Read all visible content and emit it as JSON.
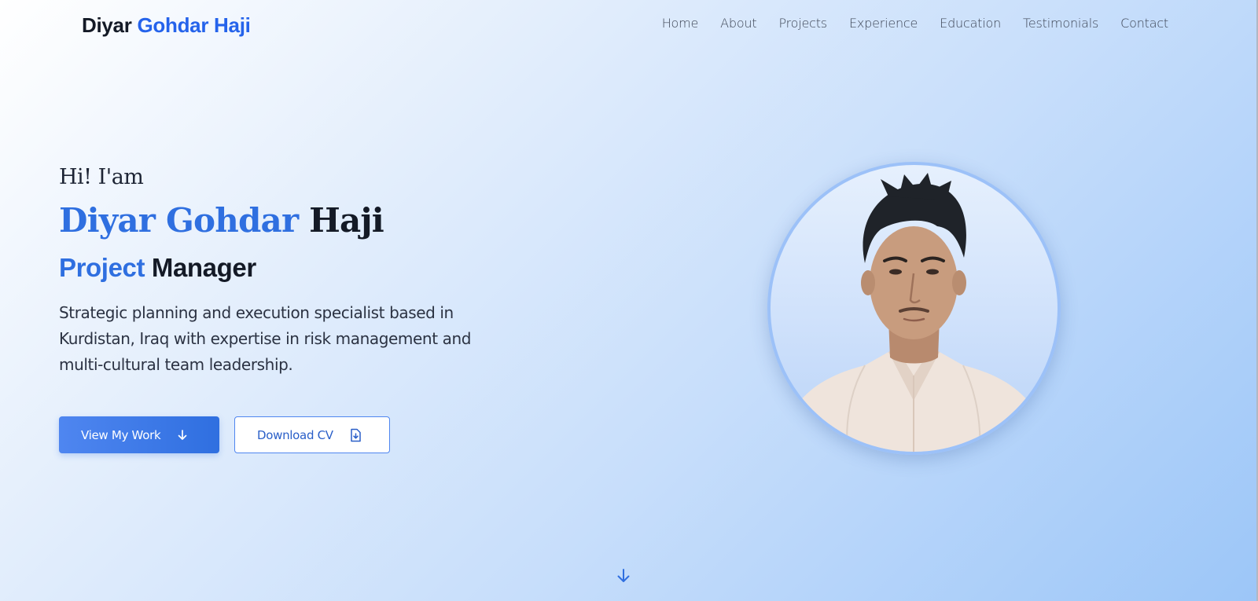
{
  "header": {
    "logo_first": "Diyar",
    "logo_rest": "Gohdar Haji",
    "nav": [
      "Home",
      "About",
      "Projects",
      "Experience",
      "Education",
      "Testimonials",
      "Contact"
    ]
  },
  "hero": {
    "greeting": "Hi! I'am",
    "name_first": "Diyar Gohdar",
    "name_rest": "Haji",
    "role_first": "Project",
    "role_rest": "Manager",
    "bio": "Strategic planning and execution specialist based in Kurdistan, Iraq with expertise in risk management and multi-cultural team leadership.",
    "primary_button": "View My Work",
    "secondary_button": "Download CV"
  },
  "icons": {
    "primary_button_icon": "arrow-down-icon",
    "secondary_button_icon": "file-download-icon",
    "scroll_indicator": "arrow-down-icon"
  },
  "colors": {
    "accent": "#2563eb",
    "text_dark": "#141a26",
    "button_bg": "#3b78e8"
  }
}
